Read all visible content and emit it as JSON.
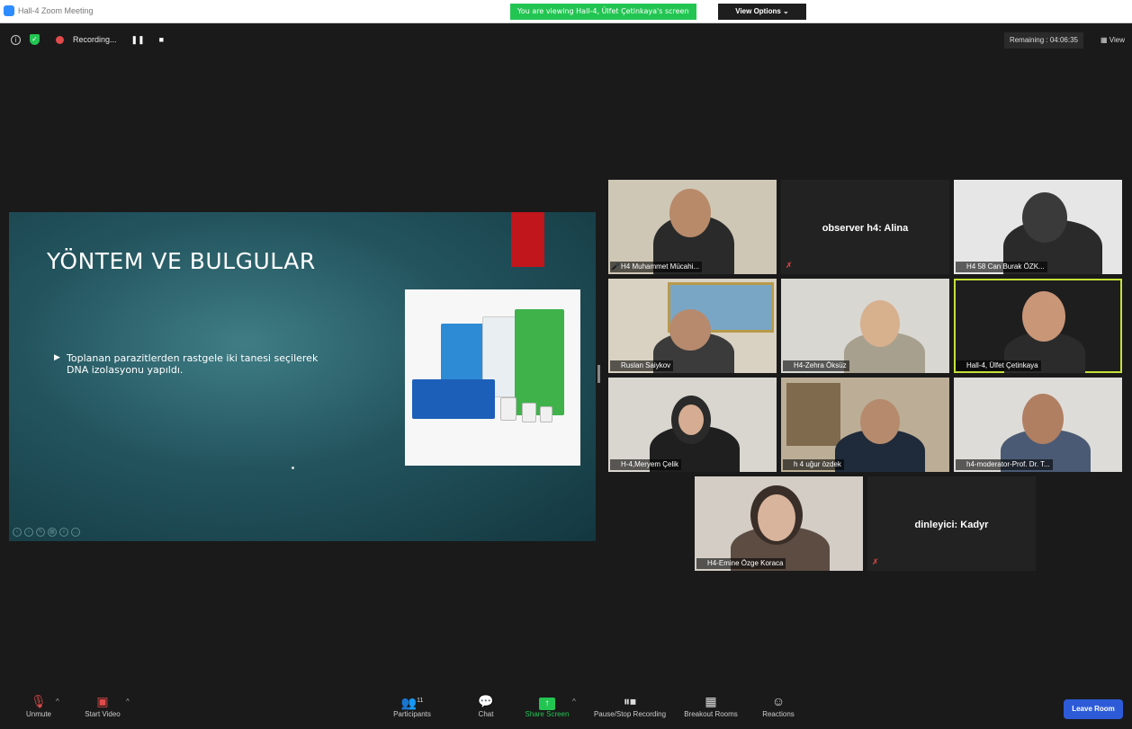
{
  "window": {
    "title": "Hall-4 Zoom Meeting"
  },
  "banner": {
    "viewing": "You are viewing Hall-4, Ülfet Çetinkaya's screen",
    "view_options": "View Options ⌄"
  },
  "top": {
    "recording_label": "Recording...",
    "remaining": "Remaining : 04:06:35",
    "view_label": "View"
  },
  "slide": {
    "heading": "YÖNTEM VE BULGULAR",
    "bullet": "Toplanan parazitlerden rastgele iki tanesi seçilerek DNA izolasyonu yapıldı."
  },
  "participants": [
    {
      "name": "H4 Muhammet Mücahi...",
      "video": true
    },
    {
      "name": "observer h4: Alina",
      "video": false
    },
    {
      "name": "H4 58 Can Burak ÖZK...",
      "video": true
    },
    {
      "name": "Ruslan Saiykov",
      "video": true
    },
    {
      "name": "H4-Zehra Öksüz",
      "video": true
    },
    {
      "name": "Hall-4, Ülfet Çetinkaya",
      "video": true,
      "active": true
    },
    {
      "name": "H-4,Meryem Çelik",
      "video": true
    },
    {
      "name": "h 4 uğur özdek",
      "video": true
    },
    {
      "name": "h4-moderator-Prof. Dr. T...",
      "video": true
    },
    {
      "name": "H4-Emine Özge Koraca",
      "video": true
    },
    {
      "name": "dinleyici: Kadyr",
      "video": false
    }
  ],
  "toolbar": {
    "unmute": "Unmute",
    "start_video": "Start Video",
    "participants": "Participants",
    "participants_count": "11",
    "chat": "Chat",
    "share_screen": "Share Screen",
    "pause_stop": "Pause/Stop Recording",
    "breakout": "Breakout Rooms",
    "reactions": "Reactions",
    "leave": "Leave Room"
  },
  "colors": {
    "accent_green": "#23c552",
    "leave_blue": "#2d5bd8",
    "active_outline": "#c5e03a",
    "muted_red": "#e04a4a"
  }
}
